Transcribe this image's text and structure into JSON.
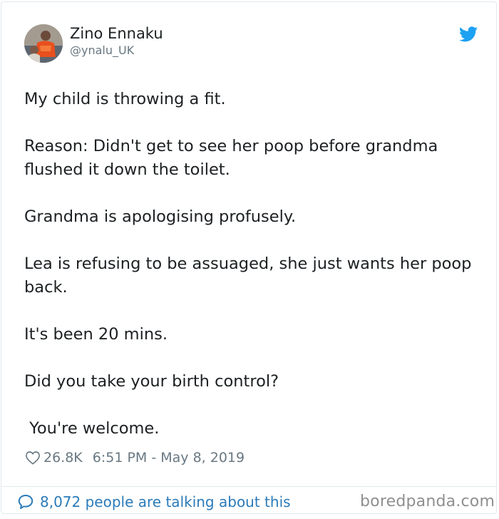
{
  "tweet": {
    "author": {
      "name": "Zino Ennaku",
      "handle": "@ynalu_UK"
    },
    "paragraphs": [
      "My child is throwing a fit.",
      "Reason: Didn't get to see her poop before grandma flushed it down the toilet.",
      "Grandma is apologising profusely.",
      "Lea is refusing to be assuaged, she just wants her poop back.",
      "It's been 20 mins.",
      "Did you take your birth control?",
      " You're welcome."
    ],
    "likes": "26.8K",
    "timestamp": "6:51 PM - May 8, 2019",
    "talking": "8,072 people are talking about this"
  },
  "watermark": "boredpanda.com",
  "colors": {
    "text": "#1c2022",
    "secondary": "#697882",
    "link": "#2b7bb9",
    "twitter_blue": "#1da1f2",
    "border": "#e1e8ed"
  },
  "icons": {
    "brand": "twitter-bird-icon",
    "like": "heart-icon",
    "reply": "speech-bubble-icon"
  }
}
